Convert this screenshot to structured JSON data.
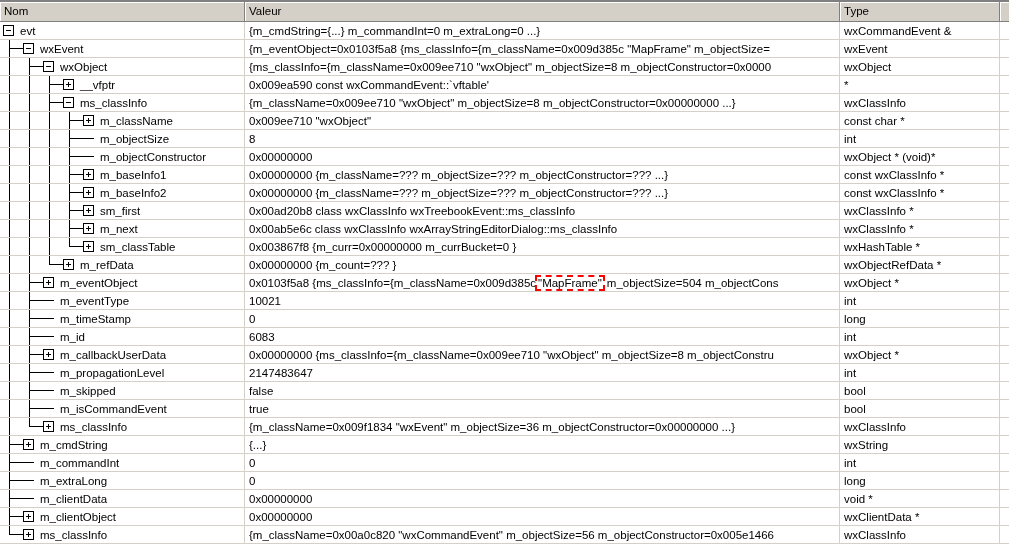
{
  "columns": [
    "Nom",
    "Valeur",
    "Type"
  ],
  "rows": [
    {
      "name": "evt",
      "value": "{m_cmdString={...} m_commandInt=0 m_extraLong=0 ...}",
      "type": "wxCommandEvent &",
      "expanded": true,
      "children": [
        {
          "name": "wxEvent",
          "value": "{m_eventObject=0x0103f5a8 {ms_classInfo={m_className=0x009d385c \"MapFrame\" m_objectSize=",
          "type": "wxEvent",
          "expanded": true,
          "children": [
            {
              "name": "wxObject",
              "value": "{ms_classInfo={m_className=0x009ee710 \"wxObject\" m_objectSize=8 m_objectConstructor=0x0000",
              "type": "wxObject",
              "expanded": true,
              "children": [
                {
                  "name": "__vfptr",
                  "value": "0x009ea590 const wxCommandEvent::`vftable'",
                  "type": "*",
                  "expanded": false
                },
                {
                  "name": "ms_classInfo",
                  "value": "{m_className=0x009ee710 \"wxObject\" m_objectSize=8 m_objectConstructor=0x00000000 ...}",
                  "type": "wxClassInfo",
                  "expanded": true,
                  "children": [
                    {
                      "name": "m_className",
                      "value": "0x009ee710 \"wxObject\"",
                      "type": "const char *",
                      "expanded": false
                    },
                    {
                      "name": "m_objectSize",
                      "value": "8",
                      "type": "int"
                    },
                    {
                      "name": "m_objectConstructor",
                      "value": "0x00000000",
                      "type": "wxObject * (void)*"
                    },
                    {
                      "name": "m_baseInfo1",
                      "value": "0x00000000 {m_className=??? m_objectSize=??? m_objectConstructor=??? ...}",
                      "type": "const wxClassInfo *",
                      "expanded": false
                    },
                    {
                      "name": "m_baseInfo2",
                      "value": "0x00000000 {m_className=??? m_objectSize=??? m_objectConstructor=??? ...}",
                      "type": "const wxClassInfo *",
                      "expanded": false
                    },
                    {
                      "name": "sm_first",
                      "value": "0x00ad20b8 class wxClassInfo wxTreebookEvent::ms_classInfo",
                      "type": "wxClassInfo *",
                      "expanded": false
                    },
                    {
                      "name": "m_next",
                      "value": "0x00ab5e6c class wxClassInfo wxArrayStringEditorDialog::ms_classInfo",
                      "type": "wxClassInfo *",
                      "expanded": false
                    },
                    {
                      "name": "sm_classTable",
                      "value": "0x003867f8 {m_curr=0x00000000 m_currBucket=0 }",
                      "type": "wxHashTable *",
                      "expanded": false
                    }
                  ]
                },
                {
                  "name": "m_refData",
                  "value": "0x00000000 {m_count=??? }",
                  "type": "wxObjectRefData *",
                  "expanded": false
                }
              ]
            },
            {
              "name": "m_eventObject",
              "value": [
                {
                  "text": "0x0103f5a8 {ms_classInfo={m_className=0x009d385c",
                  "highlighted": false
                },
                {
                  "text": "\"MapFrame\"",
                  "highlighted": true
                },
                {
                  "text": "m_objectSize=504 m_objectCons",
                  "highlighted": false
                }
              ],
              "type": "wxObject *",
              "expanded": false
            },
            {
              "name": "m_eventType",
              "value": "10021",
              "type": "int"
            },
            {
              "name": "m_timeStamp",
              "value": "0",
              "type": "long"
            },
            {
              "name": "m_id",
              "value": "6083",
              "type": "int"
            },
            {
              "name": "m_callbackUserData",
              "value": "0x00000000 {ms_classInfo={m_className=0x009ee710 \"wxObject\" m_objectSize=8 m_objectConstru",
              "type": "wxObject *",
              "expanded": false
            },
            {
              "name": "m_propagationLevel",
              "value": "2147483647",
              "type": "int"
            },
            {
              "name": "m_skipped",
              "value": "false",
              "type": "bool"
            },
            {
              "name": "m_isCommandEvent",
              "value": "true",
              "type": "bool"
            },
            {
              "name": "ms_classInfo",
              "value": "{m_className=0x009f1834 \"wxEvent\" m_objectSize=36 m_objectConstructor=0x00000000 ...}",
              "type": "wxClassInfo",
              "expanded": false
            }
          ]
        },
        {
          "name": "m_cmdString",
          "value": "{...}",
          "type": "wxString",
          "expanded": false
        },
        {
          "name": "m_commandInt",
          "value": "0",
          "type": "int"
        },
        {
          "name": "m_extraLong",
          "value": "0",
          "type": "long"
        },
        {
          "name": "m_clientData",
          "value": "0x00000000",
          "type": "void *"
        },
        {
          "name": "m_clientObject",
          "value": "0x00000000",
          "type": "wxClientData *",
          "expanded": false
        },
        {
          "name": "ms_classInfo",
          "value": "{m_className=0x00a0c820 \"wxCommandEvent\" m_objectSize=56 m_objectConstructor=0x005e1466",
          "type": "wxClassInfo",
          "expanded": false
        }
      ]
    }
  ]
}
